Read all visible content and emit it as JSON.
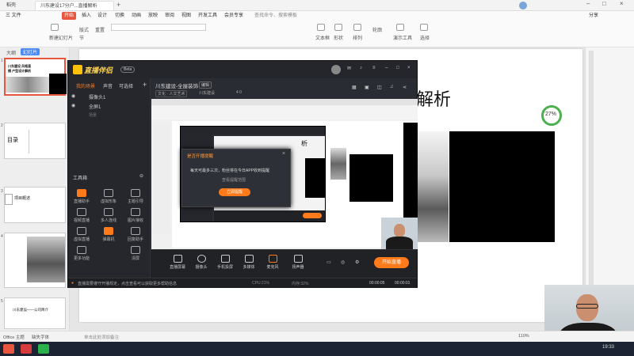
{
  "titlebar": {
    "tabs": [
      "稻壳",
      "川东建设17分户...直播解析",
      "副本"
    ],
    "search_placeholder": "搜索模板"
  },
  "menubar": {
    "items": [
      "三 文件",
      "开始",
      "插入",
      "设计",
      "切换",
      "动画",
      "放映",
      "审阅",
      "视图",
      "开发工具",
      "会员专享"
    ],
    "search": "查找命令、搜索模板",
    "right": [
      "分享"
    ]
  },
  "ribbon": {
    "items": [
      "新建幻灯片",
      "版式",
      "节",
      "重置",
      "文本框",
      "形状",
      "排列",
      "轮廓",
      "演示工具",
      "选择"
    ]
  },
  "leftpanel": {
    "tabs": [
      "大纲",
      "幻灯片"
    ],
    "slides": [
      {
        "num": "1",
        "title": "川东建设 风格直播 户型设计解析"
      },
      {
        "num": "2",
        "title": "目录"
      },
      {
        "num": "3",
        "title": "项目概述"
      },
      {
        "num": "4",
        "title": ""
      },
      {
        "num": "5",
        "title": "川东建设——公司简介"
      }
    ]
  },
  "document": {
    "title_fragment": "解析",
    "progress_badge": "27%"
  },
  "statusbar": {
    "left": [
      "Office 主题",
      "缺失字体"
    ],
    "note_placeholder": "单击此处添加备注",
    "zoom": "110%"
  },
  "app": {
    "brand": "直播伴侣",
    "brand_badge": "Beta",
    "top_tabs": [
      "我的场景",
      "声音",
      "可选择"
    ],
    "sources": [
      "摄像头1",
      "全屏1",
      "场景"
    ],
    "room_title": "川东建设-全屋装饰",
    "room_badge": "编辑",
    "room_tags": [
      "文化 · 人文艺术"
    ],
    "room_id": "川东建设",
    "room_count": "4 0",
    "toolbox_label": "工具箱",
    "tools": [
      "直播助手",
      "虚拟形象",
      "主题引导",
      "视频直播",
      "多人连线",
      "图片接收",
      "虚拟直播",
      "弹幕机",
      "回复助手",
      "更多功能",
      "清屏"
    ],
    "bottom_buttons": [
      "直播屏幕",
      "摄像头",
      "手机投屏",
      "多媒体",
      "麦克风",
      "扬声器"
    ],
    "go_live": "开始直播",
    "status_text": "直播需要遵守开播规定，点击查看可以获取更多帮助信息",
    "status_right": [
      "CPU:21%",
      "内存:32%",
      "00:00:05",
      "00:00:01"
    ]
  },
  "nested_dialog": {
    "title": "是否开播提醒",
    "body": "每天可最多三次，粉丝将在今日APP收到提醒",
    "link": "查看提醒范围",
    "button": "立即提醒"
  },
  "taskbar": {
    "apps": [
      "Office",
      "WPS"
    ],
    "time": "19:33"
  }
}
